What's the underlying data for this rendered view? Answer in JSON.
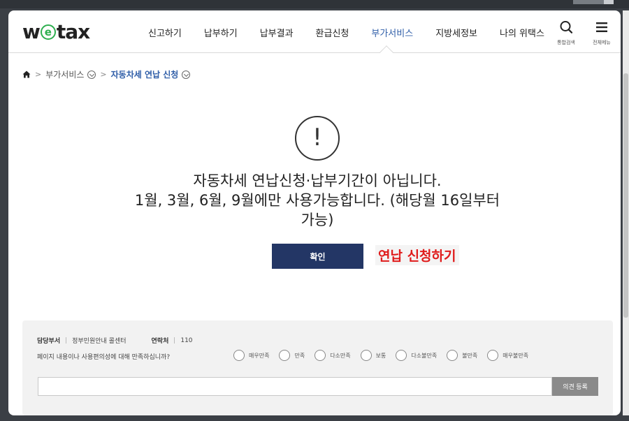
{
  "header": {
    "logo": {
      "pre": "w",
      "mid": "e",
      "post": "tax"
    },
    "nav": [
      "신고하기",
      "납부하기",
      "납부결과",
      "환급신청",
      "부가서비스",
      "지방세정보",
      "나의 위택스"
    ],
    "active_nav_index": 4,
    "search_label": "통합검색",
    "menu_label": "전체메뉴"
  },
  "breadcrumb": {
    "level1": "부가서비스",
    "level2": "자동차세 연납 신청"
  },
  "dialog": {
    "icon": "exclamation-icon",
    "message_line1": "자동차세 연납신청·납부기간이 아닙니다.",
    "message_line2": "1월, 3월, 6월, 9월에만 사용가능합니다. (해당월 16일부터",
    "message_line3": "가능)",
    "confirm_label": "확인"
  },
  "annotation": "연납 신청하기",
  "feedback": {
    "dept_label": "담당부서",
    "dept_value": "정부민원안내 콜센터",
    "contact_label": "연락처",
    "contact_value": "110",
    "question": "페이지 내용이나 사용편의성에 대해 만족하십니까?",
    "options": [
      "매우만족",
      "만족",
      "다소만족",
      "보통",
      "다소불만족",
      "불만족",
      "매우불만족"
    ],
    "submit_label": "의견 등록"
  },
  "colors": {
    "accent": "#2f5ea8",
    "button": "#233665",
    "annotation": "#e01b1b",
    "logo_e": "#2eaf4f"
  }
}
